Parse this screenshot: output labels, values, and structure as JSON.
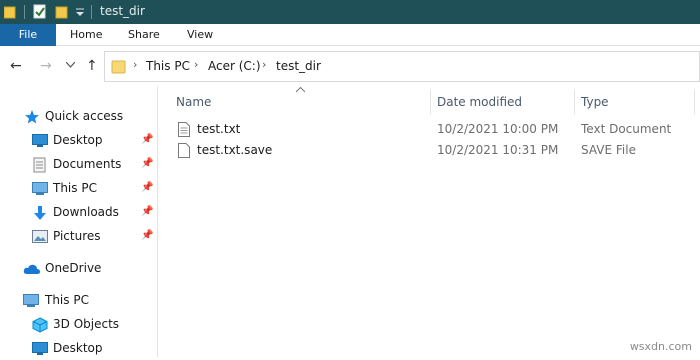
{
  "window": {
    "title": "test_dir"
  },
  "ribbon": {
    "tabs": [
      "File",
      "Home",
      "Share",
      "View"
    ]
  },
  "address": {
    "crumbs": [
      "This PC",
      "Acer (C:)",
      "test_dir"
    ]
  },
  "navpane": {
    "quick_access_label": "Quick access",
    "pinned": [
      {
        "label": "Desktop",
        "icon": "desktop-icon"
      },
      {
        "label": "Documents",
        "icon": "documents-icon"
      },
      {
        "label": "This PC",
        "icon": "this-pc-icon"
      },
      {
        "label": "Downloads",
        "icon": "downloads-icon"
      },
      {
        "label": "Pictures",
        "icon": "pictures-icon"
      }
    ],
    "onedrive_label": "OneDrive",
    "thispc_label": "This PC",
    "thispc_children": [
      {
        "label": "3D Objects",
        "icon": "3d-objects-icon"
      },
      {
        "label": "Desktop",
        "icon": "desktop-icon"
      }
    ]
  },
  "filelist": {
    "columns": [
      "Name",
      "Date modified",
      "Type"
    ],
    "rows": [
      {
        "name": "test.txt",
        "date": "10/2/2021 10:00 PM",
        "type": "Text Document",
        "icon": "text-file-icon"
      },
      {
        "name": "test.txt.save",
        "date": "10/2/2021 10:31 PM",
        "type": "SAVE File",
        "icon": "file-icon"
      }
    ]
  },
  "watermark": "wsxdn.com",
  "colors": {
    "titlebar": "#1f4f57",
    "file_tab": "#1967a6",
    "folder": "#f2c94c",
    "accent_blue": "#1e88e5"
  }
}
